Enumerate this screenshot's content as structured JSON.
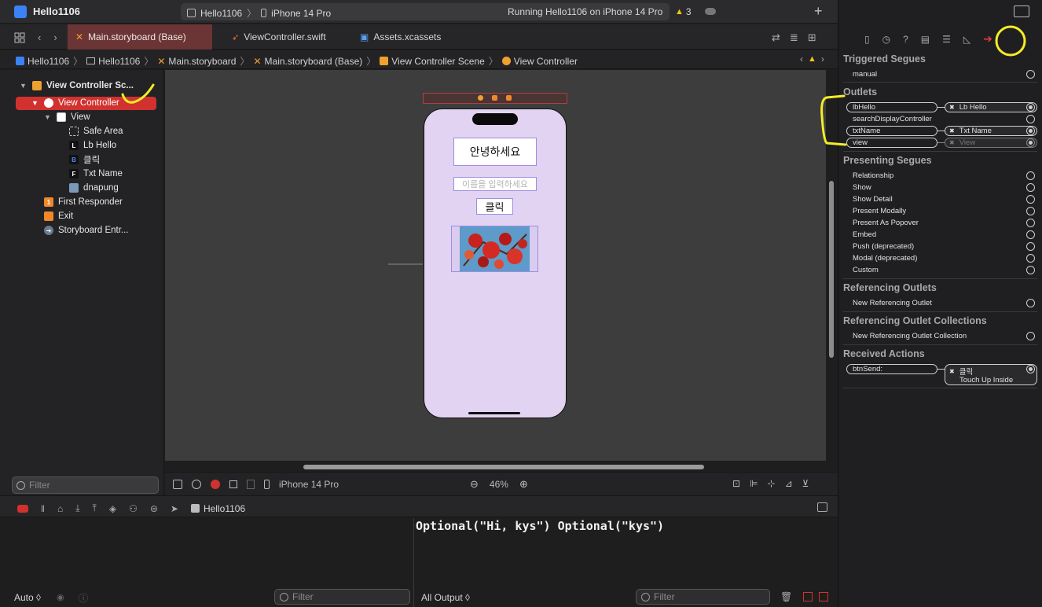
{
  "app": {
    "title": "Hello1106",
    "scheme": "Hello1106",
    "device": "iPhone 14 Pro",
    "status": "Running Hello1106 on iPhone 14 Pro",
    "warning_count": "3"
  },
  "tabs": [
    {
      "label": "Main.storyboard (Base)"
    },
    {
      "label": "ViewController.swift"
    },
    {
      "label": "Assets.xcassets"
    }
  ],
  "breadcrumb": [
    "Hello1106",
    "Hello1106",
    "Main.storyboard",
    "Main.storyboard (Base)",
    "View Controller Scene",
    "View Controller"
  ],
  "navigator": {
    "items": [
      {
        "label": "View Controller Sc..."
      },
      {
        "label": "View Controller"
      },
      {
        "label": "View"
      },
      {
        "label": "Safe Area"
      },
      {
        "label": "Lb Hello"
      },
      {
        "label": "클릭"
      },
      {
        "label": "Txt Name"
      },
      {
        "label": "dnapung"
      },
      {
        "label": "First Responder"
      },
      {
        "label": "Exit"
      },
      {
        "label": "Storyboard Entr..."
      }
    ],
    "icon_letters": {
      "label": "L",
      "button": "B",
      "textfield": "F",
      "responder": "1"
    },
    "filter_placeholder": "Filter"
  },
  "canvas": {
    "hello_label": "안녕하세요",
    "text_placeholder": "이름을 입력하세요",
    "button_label": "클릭",
    "device": "iPhone 14 Pro",
    "zoom": "46%"
  },
  "debug": {
    "target": "Hello1106",
    "console_output": "Optional(\"Hi, kys\") Optional(\"kys\")",
    "auto_label": "Auto ◊",
    "output_label": "All Output ◊",
    "filter_placeholder": "Filter"
  },
  "inspector": {
    "triggered_segues": {
      "title": "Triggered Segues",
      "items": [
        "manual"
      ]
    },
    "outlets": {
      "title": "Outlets",
      "items": [
        {
          "name": "lbHello",
          "target": "Lb Hello"
        },
        {
          "name": "searchDisplayController",
          "target": ""
        },
        {
          "name": "txtName",
          "target": "Txt Name"
        },
        {
          "name": "view",
          "target": "View"
        }
      ]
    },
    "presenting_segues": {
      "title": "Presenting Segues",
      "items": [
        "Relationship",
        "Show",
        "Show Detail",
        "Present Modally",
        "Present As Popover",
        "Embed",
        "Push (deprecated)",
        "Modal (deprecated)",
        "Custom"
      ]
    },
    "referencing_outlets": {
      "title": "Referencing Outlets",
      "items": [
        "New Referencing Outlet"
      ]
    },
    "referencing_outlet_collections": {
      "title": "Referencing Outlet Collections",
      "items": [
        "New Referencing Outlet Collection"
      ]
    },
    "received_actions": {
      "title": "Received Actions",
      "action": "btnSend:",
      "target": "클릭",
      "event": "Touch Up Inside"
    }
  },
  "colors": {
    "accent_red": "#d1322f",
    "annotation_yellow": "#f4ec27",
    "phone_bg": "#e2d3f2"
  }
}
